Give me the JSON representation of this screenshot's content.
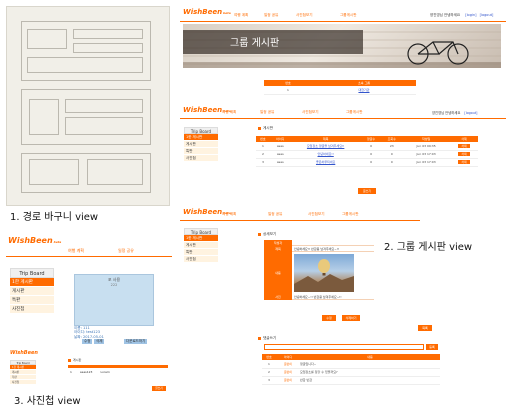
{
  "captions": {
    "route": "1. 경로 바구니 view",
    "group": "2. 그룹 게시판 view",
    "photo": "3. 사진첩 view"
  },
  "logo": {
    "text": "WishBeen",
    "beta": "beta"
  },
  "nav": {
    "trip_plan": "여행 계획",
    "schedule": "일정 공유",
    "photo_album": "사진첩보기",
    "group_board": "그룹게시판"
  },
  "header_user": {
    "greeting": "양진영님 안녕하세요",
    "login": "[login]",
    "logout": "[logout]"
  },
  "banner": {
    "title": "그룹 게시판"
  },
  "group_table": {
    "headers": [
      "번호",
      "소속 그룹"
    ],
    "row": [
      "1",
      "대한기관"
    ]
  },
  "board": {
    "title": "Trip Board",
    "items": [
      "1한 게시판",
      "게시판",
      "특판",
      "사진첩"
    ]
  },
  "board_list": {
    "heading": "게시판",
    "headers": [
      "번호",
      "아이디",
      "제목",
      "댓글수",
      "조회수",
      "작성일",
      "삭제"
    ],
    "rows": [
      [
        "1",
        "asas",
        "모임장소 댓글을 남겨주세요!!",
        "0",
        "23",
        "Jun 03 09:35",
        "삭제"
      ],
      [
        "2",
        "asas",
        "안녕하세요!!",
        "0",
        "0",
        "Jun 03 17:03",
        "삭제"
      ],
      [
        "3",
        "asas",
        "좋은하루되세요",
        "0",
        "0",
        "Jun 03 17:03",
        "삭제"
      ]
    ],
    "write_btn": "글쓰기"
  },
  "detail": {
    "heading": "상세보기",
    "labels": {
      "author": "작성자",
      "title": "제목",
      "content": "내용",
      "photo": "사진"
    },
    "title_value": "안녕하세요!! 반갑용 남겨주세요~!!",
    "content_value": "안녕하세요~!! 반갑용 남겨주세요~!!",
    "edit_btn": "수정",
    "delete_btn": "삭제하기",
    "list_btn": "목록"
  },
  "comments": {
    "heading": "댓글쓰기",
    "submit": "등록",
    "headers": [
      "번호",
      "아이디",
      "내용"
    ],
    "rows": [
      [
        "1",
        "글쓴이",
        "댓글입니다~"
      ],
      [
        "2",
        "글쓴이",
        "모임장소를 정할 수 있을까요?"
      ],
      [
        "3",
        "글쓴이",
        "반갑 반갑"
      ]
    ]
  },
  "photo_view": {
    "board_title": "Trip Board",
    "items": [
      "1한 게시판",
      "게시판",
      "특판",
      "사진첩"
    ],
    "photo_title": "포 사용",
    "photo_sub": "222",
    "info": [
      "이름: 111",
      "아이디: test123",
      "날짜: 2017-05-01"
    ],
    "btn_a": "수정",
    "btn_b": "삭제",
    "btn_c": "다운로드하기",
    "mini_heading": "게시판",
    "mini_row": [
      "1",
      "asas123",
      "Lorem"
    ],
    "mini_btn": "글쓰기"
  },
  "colors": {
    "accent": "#ff6b00",
    "photo_bg": "#c8dff0"
  }
}
